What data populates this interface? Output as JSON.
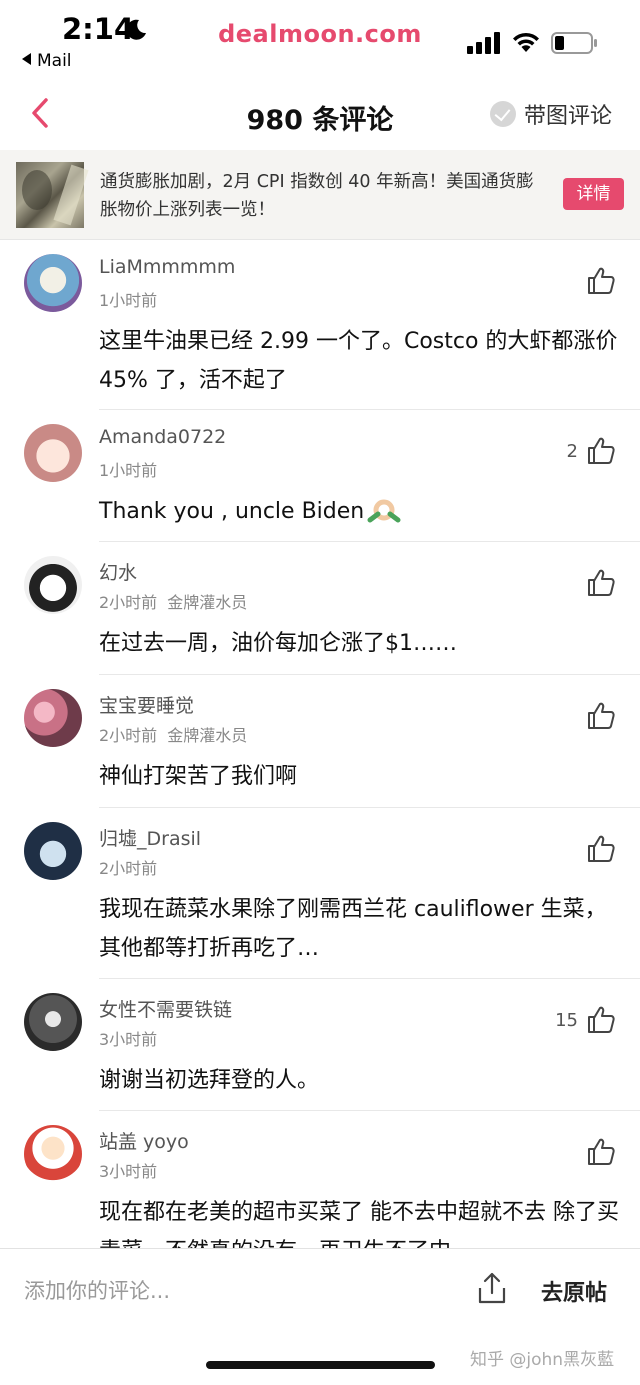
{
  "status_bar": {
    "time": "2:14",
    "back_app": "Mail",
    "site": "dealmoon.com"
  },
  "nav": {
    "title": "980 条评论",
    "right_label": "带图评论"
  },
  "banner": {
    "text": "通货膨胀加剧，2月 CPI 指数创 40 年新高！美国通货膨胀物价上涨列表一览！",
    "button": "详情"
  },
  "comments": [
    {
      "username": "LiaMmmmmm",
      "time": "1小时前",
      "badge": "",
      "likes": "",
      "text": "这里牛油果已经 2.99 一个了。Costco 的大虾都涨价 45% 了，活不起了"
    },
    {
      "username": "Amanda0722",
      "time": "1小时前",
      "badge": "",
      "likes": "2",
      "text": "Thank you , uncle Biden"
    },
    {
      "username": "幻水",
      "time": "2小时前",
      "badge": "金牌灌水员",
      "likes": "",
      "text": "在过去一周，油价每加仑涨了$1……"
    },
    {
      "username": "宝宝要睡觉",
      "time": "2小时前",
      "badge": "金牌灌水员",
      "likes": "",
      "text": "神仙打架苦了我们啊"
    },
    {
      "username": "归墟_Drasil",
      "time": "2小时前",
      "badge": "",
      "likes": "",
      "text": "我现在蔬菜水果除了刚需西兰花 cauliflower 生菜，其他都等打折再吃了…"
    },
    {
      "username": "女性不需要铁链",
      "time": "3小时前",
      "badge": "",
      "likes": "15",
      "text": "谢谢当初选拜登的人。"
    },
    {
      "username": "站盖 yoyo",
      "time": "3小时前",
      "badge": "",
      "likes": "",
      "text": "现在都在老美的超市买菜了 能不去中超就不去 除了买青菜，不然真的没有，再卫生不了中"
    }
  ],
  "bottom_bar": {
    "placeholder": "添加你的评论...",
    "to_post": "去原帖",
    "watermark": "知乎 @john黑灰藍"
  },
  "colors": {
    "brand": "#e64a6e",
    "text_primary": "#111111",
    "text_secondary": "#888888"
  }
}
